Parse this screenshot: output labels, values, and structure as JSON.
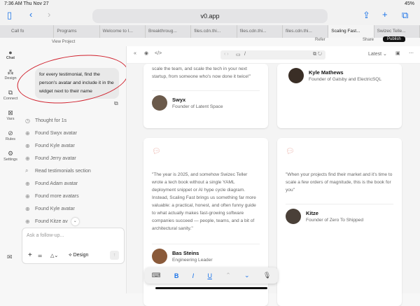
{
  "status": {
    "time": "7:36 AM",
    "date": "Thu Nov 27",
    "battery": "45%"
  },
  "browser": {
    "url": "v0.app",
    "tabs": [
      "Call fo",
      "Programs",
      "Welcome to I...",
      "Breakthroug...",
      "files.cdn.thi...",
      "files.cdn.thi...",
      "files.cdn.thi...",
      "Scaling Fast...",
      "Swizec Telle..."
    ],
    "active_tab": 7
  },
  "header": {
    "view_project": "View Project",
    "refer": "Refer",
    "share": "Share",
    "publish": "Publish"
  },
  "rail": [
    {
      "label": "Chat",
      "icon": "chat-icon",
      "g": "●"
    },
    {
      "label": "Design",
      "icon": "design-icon",
      "g": "⁂"
    },
    {
      "label": "Connect",
      "icon": "connect-icon",
      "g": "⧉"
    },
    {
      "label": "Vars",
      "icon": "vars-icon",
      "g": "⊠"
    },
    {
      "label": "Rules",
      "icon": "rules-icon",
      "g": "⊘"
    },
    {
      "label": "Settings",
      "icon": "settings-icon",
      "g": "⚙"
    }
  ],
  "chat": {
    "message": "for every testimonial, find the person's avatar and include it in the widget next to their name",
    "steps": [
      {
        "icon": "clock",
        "text": "Thought for 1s"
      },
      {
        "icon": "globe",
        "text": "Found Swyx avatar"
      },
      {
        "icon": "globe",
        "text": "Found Kyle avatar"
      },
      {
        "icon": "globe",
        "text": "Found Jerry avatar"
      },
      {
        "icon": "search",
        "text": "Read testimonials section"
      },
      {
        "icon": "globe",
        "text": "Found Adam avatar"
      },
      {
        "icon": "globe",
        "text": "Found more avatars"
      },
      {
        "icon": "globe",
        "text": "Found Kyle avatar"
      },
      {
        "icon": "globe",
        "text": "Found Kitze av"
      }
    ],
    "placeholder": "Ask a follow-up...",
    "design": "Design"
  },
  "preview": {
    "path": "/",
    "version": "Latest"
  },
  "cards": [
    {
      "quote": "scale the team, and scale the tech in your next startup, from someone who's now done it twice!\"",
      "name": "Swyx",
      "role": "Founder of Latent Space"
    },
    {
      "name": "Kyle Mathews",
      "role": "Founder of Gatsby and ElectricSQL"
    },
    {
      "quote": "\"The year is 2025, and somehow Swizec Teller wrote a tech book without a single YAML deployment snippet or AI hype cycle diagram. Instead, Scaling Fast brings us something far more valuable: a practical, honest, and often funny guide to what actually makes fast-growing software companies succeed — people, teams, and a bit of architectural sanity.\"",
      "name": "Bas Steins",
      "role": "Engineering Leader"
    },
    {
      "quote": "\"When your projects find their market and it's time to scale a few orders of magnitude, this is the book for you\"",
      "name": "Kitze",
      "role": "Founder of Zero To Shipped"
    }
  ],
  "keyboard": {
    "bold": "B",
    "italic": "I",
    "underline": "U"
  }
}
